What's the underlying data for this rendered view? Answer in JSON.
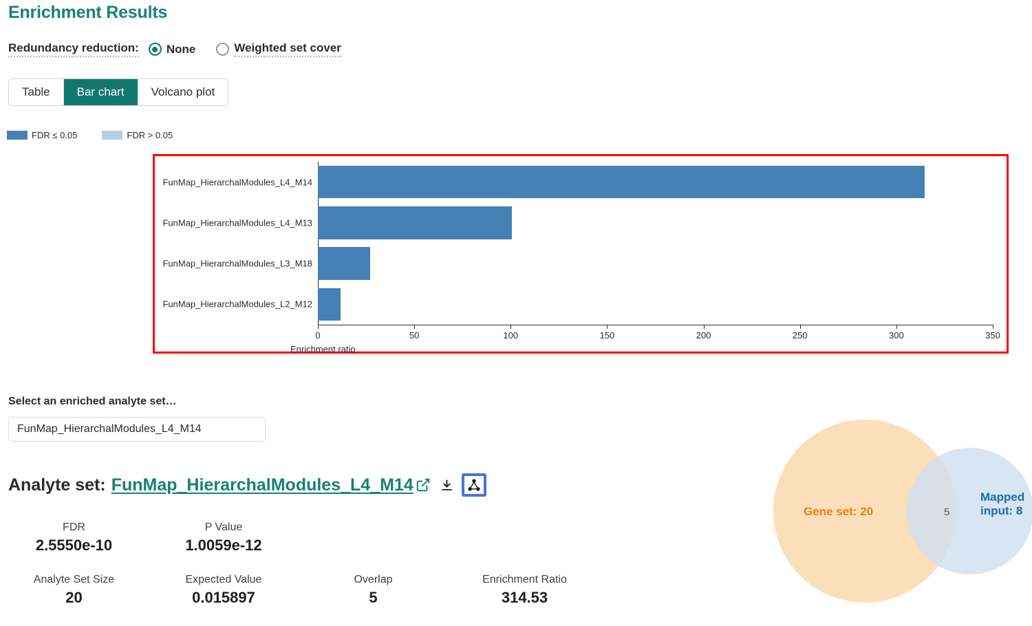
{
  "page": {
    "title": "Enrichment Results",
    "title_color": "#17817a"
  },
  "redundancy": {
    "label": "Redundancy reduction:",
    "options": [
      {
        "label": "None",
        "selected": true
      },
      {
        "label": "Weighted set cover",
        "selected": false
      }
    ]
  },
  "tabs": [
    {
      "label": "Table",
      "active": false
    },
    {
      "label": "Bar chart",
      "active": true
    },
    {
      "label": "Volcano plot",
      "active": false
    }
  ],
  "legend": [
    {
      "label": "FDR ≤ 0.05",
      "color": "#4581b4"
    },
    {
      "label": "FDR > 0.05",
      "color": "#b8cde3"
    }
  ],
  "chart_data": {
    "type": "bar",
    "orientation": "horizontal",
    "title": "",
    "xlabel": "Enrichment ratio",
    "ylabel": "",
    "xlim": [
      0,
      350
    ],
    "xticks": [
      0,
      50,
      100,
      150,
      200,
      250,
      300,
      350
    ],
    "xtick_labels": [
      "0",
      "50",
      "100",
      "150",
      "200",
      "250",
      "300",
      "350"
    ],
    "grid": false,
    "legend_position": "top-left",
    "bar_color": "#4581b4",
    "categories": [
      "FunMap_HierarchalModules_L4_M14",
      "FunMap_HierarchalModules_L4_M13",
      "FunMap_HierarchalModules_L3_M18",
      "FunMap_HierarchalModules_L2_M12"
    ],
    "values": [
      314.53,
      100.7,
      27.2,
      11.9
    ],
    "series": [
      {
        "name": "FDR ≤ 0.05",
        "values": [
          314.53,
          100.7,
          27.2,
          11.9
        ]
      }
    ]
  },
  "selector": {
    "label": "Select an enriched analyte set…",
    "value": "FunMap_HierarchalModules_L4_M14",
    "placeholder": "Select an enriched analyte set…"
  },
  "analyte": {
    "heading_prefix": "Analyte set:",
    "name": "FunMap_HierarchalModules_L4_M14",
    "external_link_icon": "external-link-icon",
    "download_icon": "download-icon",
    "network_icon": "network-graph-icon"
  },
  "stats": [
    {
      "label": "FDR",
      "value": "2.5550e-10"
    },
    {
      "label": "P Value",
      "value": "1.0059e-12"
    },
    {
      "label": "Analyte Set Size",
      "value": "20"
    },
    {
      "label": "Expected Value",
      "value": "0.015897"
    },
    {
      "label": "Overlap",
      "value": "5"
    },
    {
      "label": "Enrichment Ratio",
      "value": "314.53"
    }
  ],
  "venn": {
    "left_label": "Gene set: 20",
    "right_label": "Mapped\ninput: 8",
    "intersection_label": "5",
    "left_color": "#fbdfbb",
    "right_color": "#cfdff0",
    "left_text_color": "#f07e13",
    "right_text_color": "#1a6dad",
    "intersection_text_color": "#555555"
  }
}
